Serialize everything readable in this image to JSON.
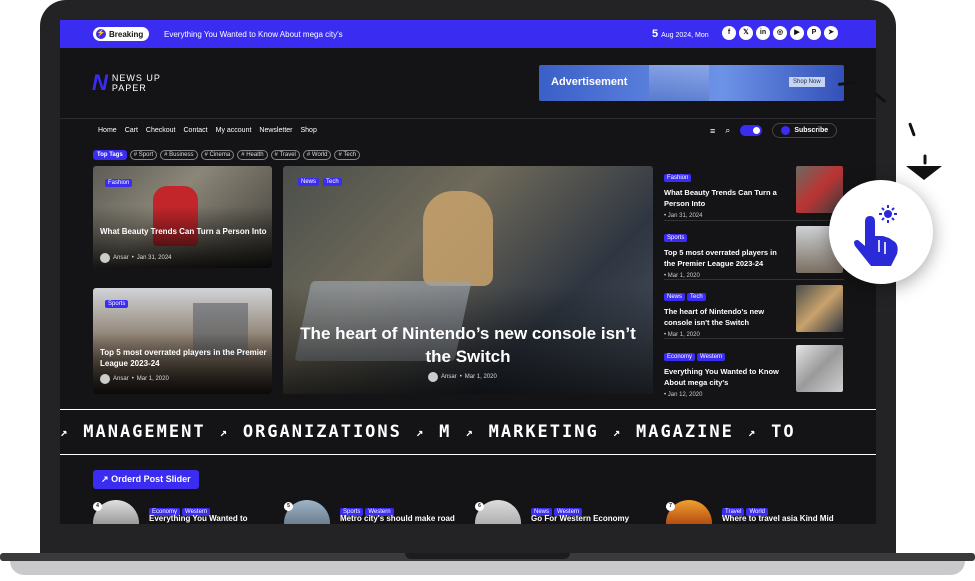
{
  "topbar": {
    "breaking_label": "Breaking",
    "ticker_text": "Everything You Wanted to Know About mega city's",
    "date_day": "5",
    "date_rest": "Aug 2024, Mon",
    "socials": [
      "f",
      "𝕏",
      "in",
      "◎",
      "▶",
      "P",
      "➤"
    ]
  },
  "logo": {
    "line1": "NEWS UP",
    "line2": "PAPER"
  },
  "ad": {
    "label": "Advertisement",
    "button": "Shop Now"
  },
  "nav": {
    "items": [
      "Home",
      "Cart",
      "Checkout",
      "Contact",
      "My account",
      "Newsletter",
      "Shop"
    ],
    "subscribe": "Subscribe"
  },
  "tags": {
    "label": "Top Tags",
    "items": [
      "# Sport",
      "# Business",
      "# Cinema",
      "# Health",
      "# Travel",
      "# World",
      "# Tech"
    ]
  },
  "cards": {
    "left_top": {
      "badge": "Fashion",
      "title": "What Beauty Trends Can Turn a Person Into",
      "author": "Ansar",
      "date": "Jan 31, 2024"
    },
    "left_bottom": {
      "badge": "Sports",
      "title": "Top 5 most overrated players in the Premier League 2023-24",
      "author": "Ansar",
      "date": "Mar 1, 2020"
    },
    "hero": {
      "badge1": "News",
      "badge2": "Tech",
      "title": "The heart of Nintendo’s new console isn’t the Switch",
      "author": "Ansar",
      "date": "Mar 1, 2020"
    }
  },
  "sidebar": [
    {
      "badges": [
        "Fashion"
      ],
      "title": "What Beauty Trends Can Turn a Person Into",
      "date": "Jan 31, 2024"
    },
    {
      "badges": [
        "Sports"
      ],
      "title": "Top 5 most overrated players in the Premier League 2023-24",
      "date": "Mar 1, 2020"
    },
    {
      "badges": [
        "News",
        "Tech"
      ],
      "title": "The heart of Nintendo's new console isn't the Switch",
      "date": "Mar 1, 2020"
    },
    {
      "badges": [
        "Economy",
        "Western"
      ],
      "title": "Everything You Wanted to Know About mega city's",
      "date": "Jan 12, 2020"
    }
  ],
  "marquee": [
    "MANAGEMENT",
    "ORGANIZATIONS",
    "M",
    "MARKETING",
    "MAGAZINE",
    "TO"
  ],
  "slider": {
    "heading": "Orderd Post Slider",
    "items": [
      {
        "num": "4",
        "badges": [
          "Economy",
          "Western"
        ],
        "title": "Everything You Wanted to"
      },
      {
        "num": "5",
        "badges": [
          "Sports",
          "Western"
        ],
        "title": "Metro city's should make road"
      },
      {
        "num": "6",
        "badges": [
          "News",
          "Western"
        ],
        "title": "Go For Western Economy"
      },
      {
        "num": "7",
        "badges": [
          "Travel",
          "World"
        ],
        "title": "Where to travel asia Kind Mid"
      }
    ]
  }
}
